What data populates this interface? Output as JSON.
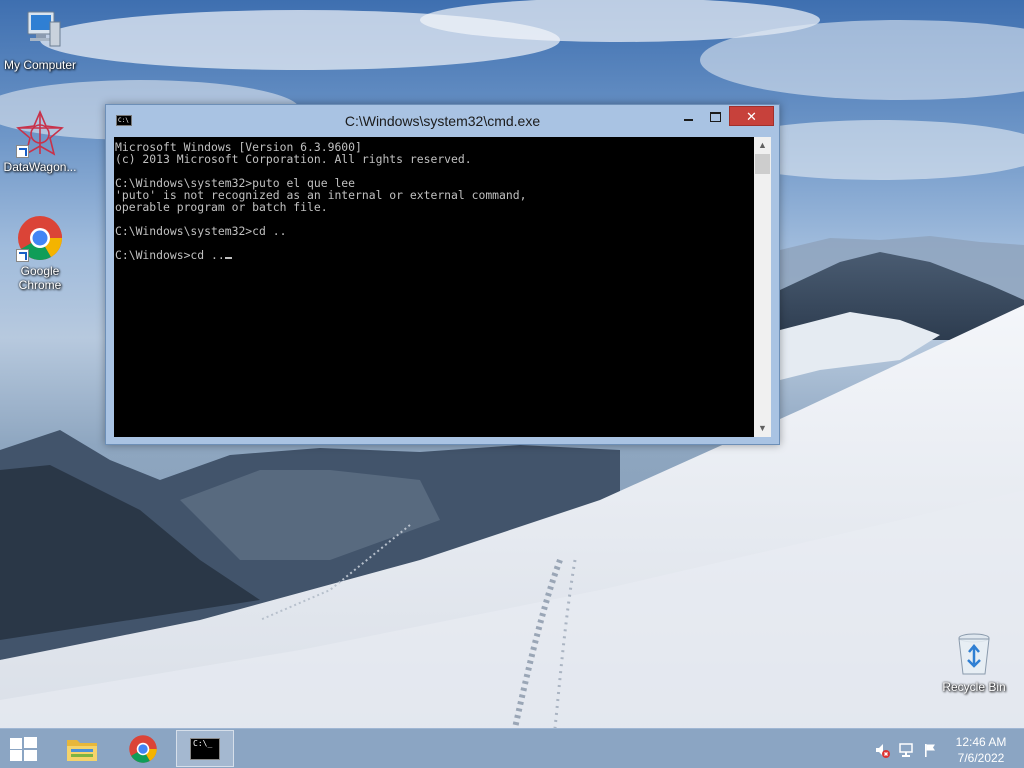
{
  "desktop": {
    "icons": [
      {
        "label": "My Computer",
        "icon": "computer-icon"
      },
      {
        "label": "DataWagon...",
        "icon": "datawagon-icon"
      },
      {
        "label": "Google Chrome",
        "icon": "chrome-icon"
      },
      {
        "label": "Recycle Bin",
        "icon": "recycle-bin-icon"
      }
    ]
  },
  "window": {
    "title": "C:\\Windows\\system32\\cmd.exe",
    "title_icon_text": "C:\\",
    "console_lines": [
      "Microsoft Windows [Version 6.3.9600]",
      "(c) 2013 Microsoft Corporation. All rights reserved.",
      "",
      "C:\\Windows\\system32>puto el que lee",
      "'puto' is not recognized as an internal or external command,",
      "operable program or batch file.",
      "",
      "C:\\Windows\\system32>cd ..",
      "",
      "C:\\Windows>cd .."
    ],
    "buttons": {
      "minimize": "minimize",
      "maximize": "maximize",
      "close": "close"
    }
  },
  "taskbar": {
    "items": [
      {
        "icon": "file-explorer-icon"
      },
      {
        "icon": "chrome-icon"
      },
      {
        "icon": "command-prompt-icon",
        "label": "C:\\_",
        "active": true
      }
    ],
    "tray": {
      "icons": [
        "volume-muted-icon",
        "network-icon",
        "action-center-flag-icon"
      ],
      "time": "12:46 AM",
      "date": "7/6/2022"
    }
  },
  "colors": {
    "close_button": "#c7413b",
    "console_bg": "#000000",
    "console_fg": "#c0c0c0",
    "window_frame": "#a9c3e3"
  }
}
